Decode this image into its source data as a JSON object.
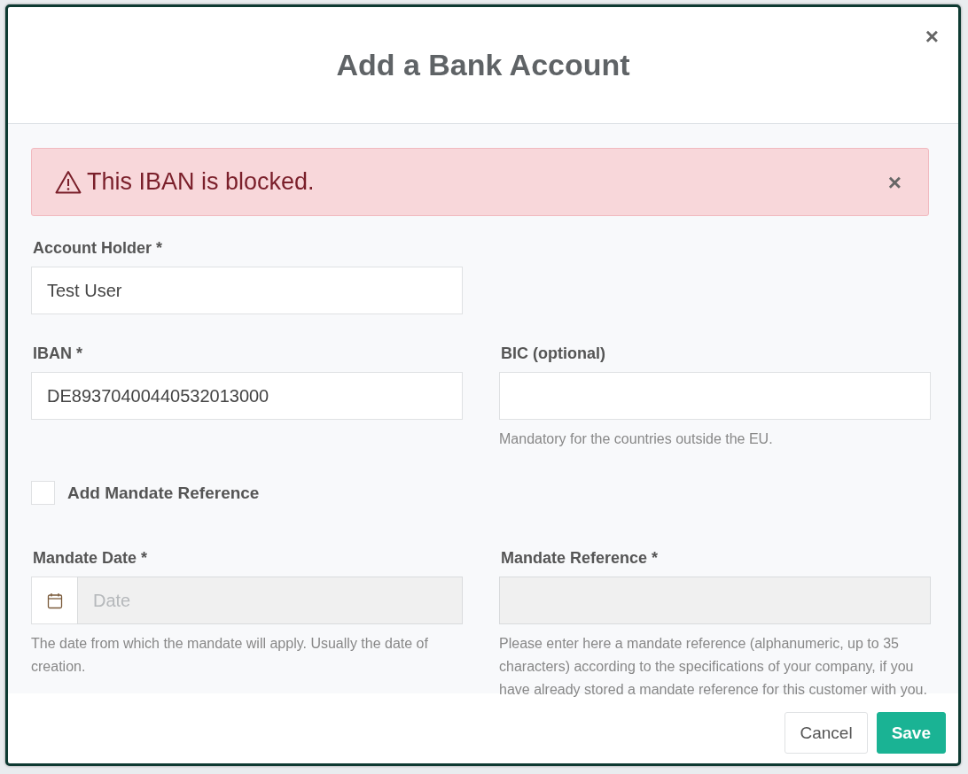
{
  "dialog": {
    "title": "Add a Bank Account",
    "close_label": "×"
  },
  "alert": {
    "message": "This IBAN is blocked.",
    "close_label": "×"
  },
  "rows": [
    {
      "fields": [
        {
          "kind": "text",
          "label": "Account Holder *",
          "value": "Test User",
          "disabled": false
        }
      ]
    },
    {
      "fields": [
        {
          "kind": "text",
          "label": "IBAN *",
          "value": "DE89370400440532013000",
          "disabled": false
        },
        {
          "kind": "text",
          "label": "**BIC** (optional)",
          "disabled": false,
          "help": "Mandatory for the countries outside the EU."
        }
      ]
    },
    {
      "fields": [
        {
          "kind": "checkbox",
          "label": "Add Mandate Reference",
          "checked": false
        }
      ]
    },
    {
      "fields": [
        {
          "kind": "date",
          "label": "Mandate Date *",
          "placeholder": "Date",
          "disabled": true,
          "help": "The date from which the mandate will apply. Usually the date of creation."
        },
        {
          "kind": "text",
          "label": "Mandate Reference *",
          "disabled": true,
          "help": "Please enter here a mandate reference (alphanumeric, up to 35 characters) according to the specifications of your company, if you have already stored a mandate reference for this customer with you."
        }
      ]
    }
  ],
  "buttons": [
    {
      "label": "Cancel",
      "kind": "secondary"
    },
    {
      "label": "Save",
      "kind": "primary"
    }
  ]
}
